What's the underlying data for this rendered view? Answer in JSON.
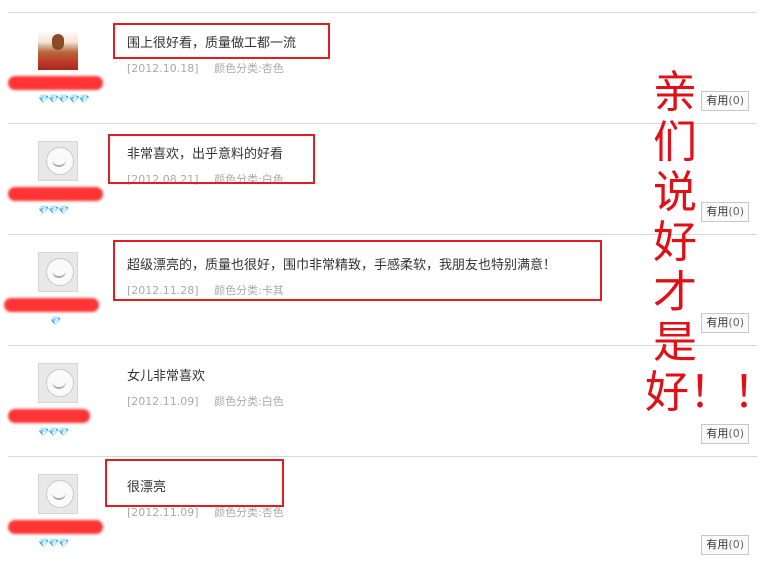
{
  "reviews": [
    {
      "username": "",
      "rank": "💎💎💎💎💎",
      "comment": "围上很好看，质量做工都一流",
      "date": "[2012.10.18]",
      "attr": "颜色分类:杏色",
      "useful_label": "有用",
      "useful_count": "(0)"
    },
    {
      "username": "",
      "rank": "💎💎💎",
      "comment": "非常喜欢，出乎意料的好看",
      "date": "[2012.08.21]",
      "attr": "颜色分类:白色",
      "useful_label": "有用",
      "useful_count": "(0)"
    },
    {
      "username": "",
      "rank": "💎",
      "comment": "超级漂亮的，质量也很好，围巾非常精致，手感柔软，我朋友也特别满意！",
      "date": "[2012.11.28]",
      "attr": "颜色分类:卡其",
      "useful_label": "有用",
      "useful_count": "(0)"
    },
    {
      "username": "",
      "rank": "💎💎💎",
      "comment": "女儿非常喜欢",
      "date": "[2012.11.09]",
      "attr": "颜色分类:白色",
      "useful_label": "有用",
      "useful_count": "(0)"
    },
    {
      "username": "",
      "rank": "💎💎💎",
      "comment": "很漂亮",
      "date": "[2012.11.09]",
      "attr": "颜色分类:杏色",
      "useful_label": "有用",
      "useful_count": "(0)"
    }
  ],
  "annotation": {
    "text": "亲们说好才是好！！",
    "color": "#e10f16"
  },
  "highlight_color": "#e11d24"
}
